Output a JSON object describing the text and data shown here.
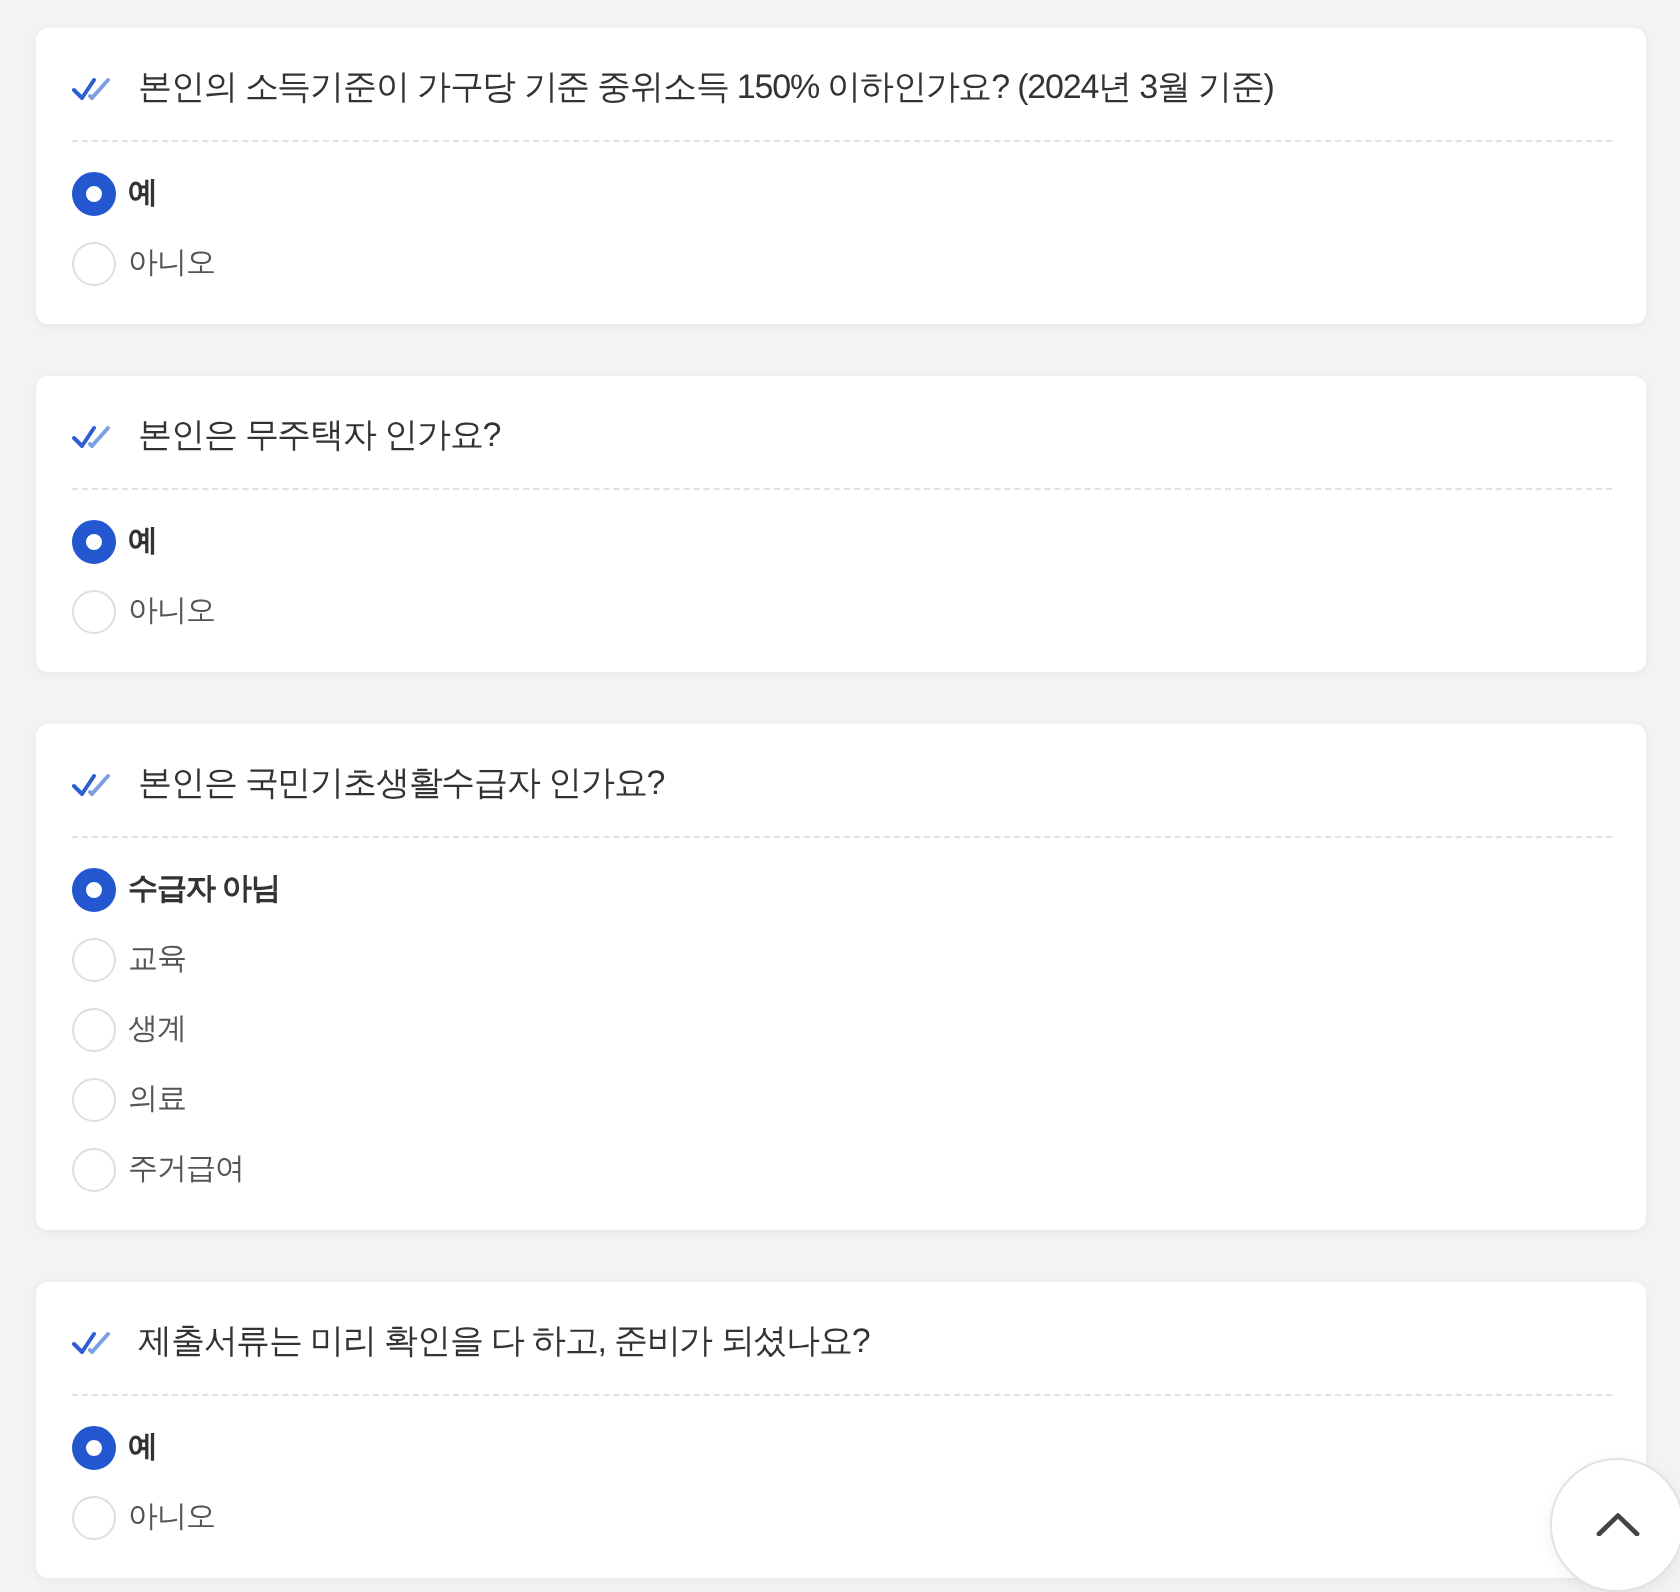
{
  "questions": [
    {
      "title": "본인의 소득기준이 가구당 기준 중위소득 150% 이하인가요? (2024년 3월 기준)",
      "options": [
        {
          "label": "예",
          "selected": true
        },
        {
          "label": "아니오",
          "selected": false
        }
      ]
    },
    {
      "title": "본인은 무주택자 인가요?",
      "options": [
        {
          "label": "예",
          "selected": true
        },
        {
          "label": "아니오",
          "selected": false
        }
      ]
    },
    {
      "title": "본인은 국민기초생활수급자 인가요?",
      "options": [
        {
          "label": "수급자 아님",
          "selected": true
        },
        {
          "label": "교육",
          "selected": false
        },
        {
          "label": "생계",
          "selected": false
        },
        {
          "label": "의료",
          "selected": false
        },
        {
          "label": "주거급여",
          "selected": false
        }
      ]
    },
    {
      "title": "제출서류는 미리 확인을 다 하고, 준비가 되셨나요?",
      "options": [
        {
          "label": "예",
          "selected": true
        },
        {
          "label": "아니오",
          "selected": false
        }
      ]
    }
  ]
}
